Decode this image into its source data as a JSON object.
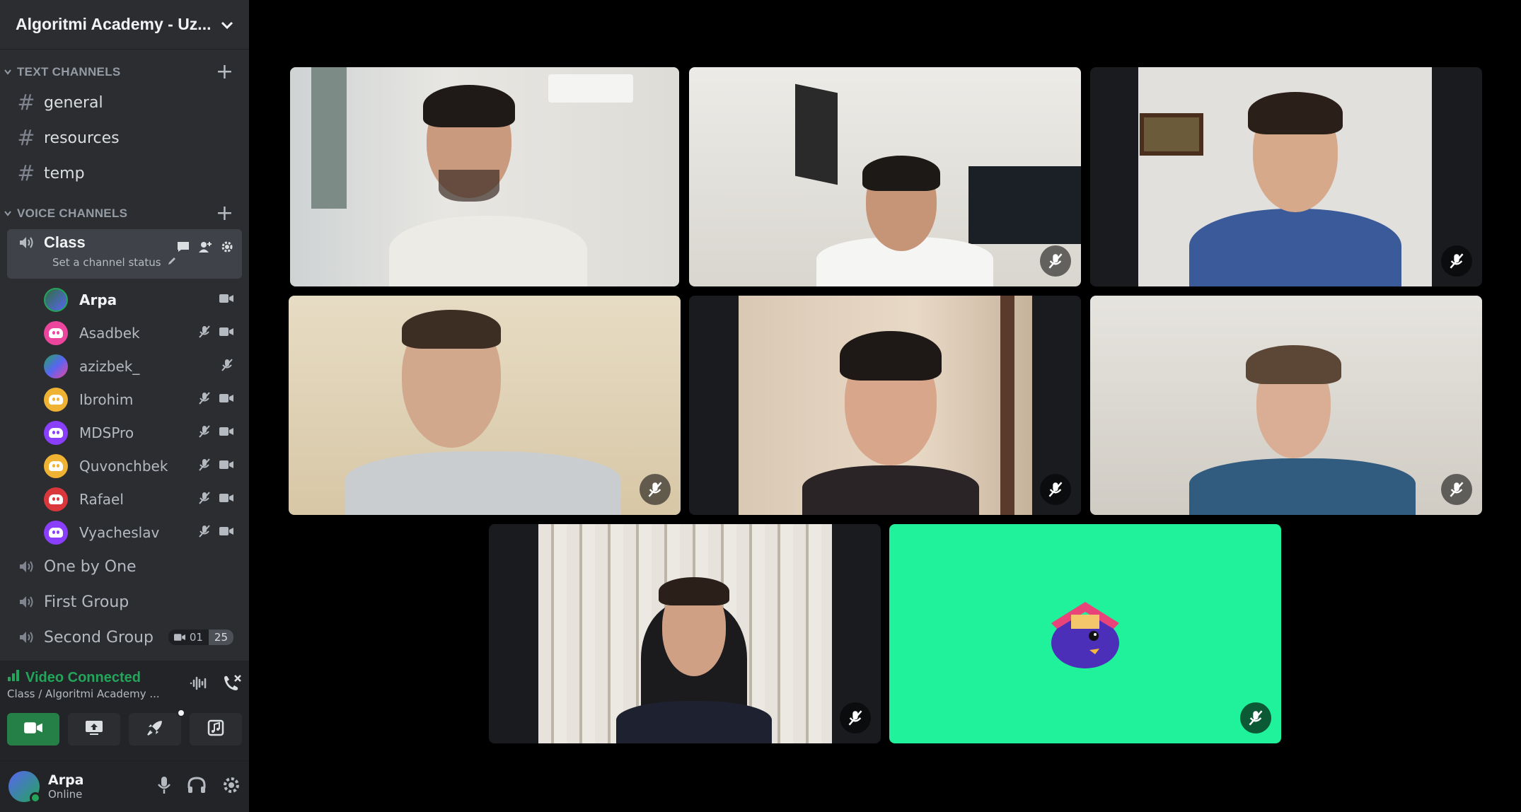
{
  "server": {
    "name": "Algoritmi Academy - Uz..."
  },
  "text_category": {
    "label": "TEXT CHANNELS"
  },
  "text_channels": [
    {
      "label": "general"
    },
    {
      "label": "resources"
    },
    {
      "label": "temp"
    }
  ],
  "voice_category": {
    "label": "VOICE CHANNELS"
  },
  "active_voice": {
    "name": "Class",
    "status_placeholder": "Set a channel status"
  },
  "voice_users": [
    {
      "name": "Arpa",
      "color": "#5865f2",
      "muted": false,
      "camera": true
    },
    {
      "name": "Asadbek",
      "color": "#eb459e",
      "muted": true,
      "camera": true
    },
    {
      "name": "azizbek_",
      "color": "#23a55a",
      "muted": true,
      "camera": false
    },
    {
      "name": "Ibrohim",
      "color": "#f0b232",
      "muted": true,
      "camera": true
    },
    {
      "name": "MDSPro",
      "color": "#8a3ffc",
      "muted": true,
      "camera": true
    },
    {
      "name": "Quvonchbek",
      "color": "#f0b232",
      "muted": true,
      "camera": true
    },
    {
      "name": "Rafael",
      "color": "#da373c",
      "muted": true,
      "camera": true
    },
    {
      "name": "Vyacheslav",
      "color": "#8a3ffc",
      "muted": true,
      "camera": true
    }
  ],
  "other_voice_channels": [
    {
      "label": "One by One"
    },
    {
      "label": "First Group"
    },
    {
      "label": "Second Group",
      "badge_a": "01",
      "badge_b": "25"
    }
  ],
  "connection": {
    "status": "Video Connected",
    "detail": "Class / Algoritmi Academy ..."
  },
  "user_panel": {
    "name": "Arpa",
    "status": "Online"
  },
  "colors": {
    "accent_green": "#23a55a",
    "sidebar_bg": "#2b2d31",
    "tile_green": "#1ff29a"
  },
  "video_tiles": [
    {
      "name": "tile-speaker",
      "muted": false,
      "speaking": true
    },
    {
      "name": "tile-2",
      "muted": true
    },
    {
      "name": "tile-3",
      "muted": true
    },
    {
      "name": "tile-4",
      "muted": true
    },
    {
      "name": "tile-5",
      "muted": true
    },
    {
      "name": "tile-6",
      "muted": true
    },
    {
      "name": "tile-7",
      "muted": true
    },
    {
      "name": "tile-avatar",
      "muted": true
    }
  ]
}
